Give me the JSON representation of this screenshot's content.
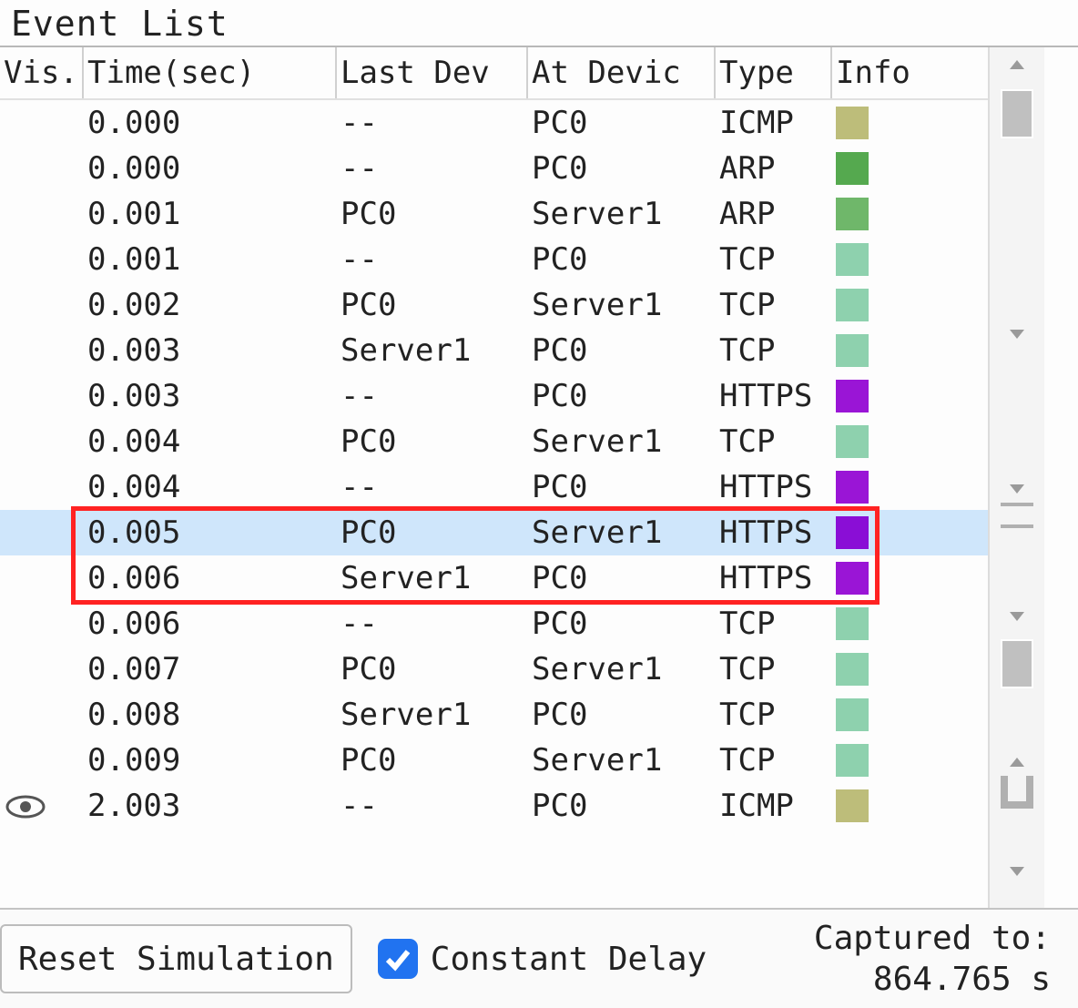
{
  "title": "Event List",
  "headers": {
    "vis": "Vis.",
    "time": "Time(sec)",
    "last": "Last Dev",
    "at": "At Devic",
    "type": "Type",
    "info": "Info"
  },
  "rows": [
    {
      "vis": "",
      "time": "0.000",
      "last": "--",
      "at": "PC0",
      "type": "ICMP",
      "color": "#bdbd7a",
      "sel": false
    },
    {
      "vis": "",
      "time": "0.000",
      "last": "--",
      "at": "PC0",
      "type": "ARP",
      "color": "#55a94f",
      "sel": false
    },
    {
      "vis": "",
      "time": "0.001",
      "last": "PC0",
      "at": "Server1",
      "type": "ARP",
      "color": "#6fb76a",
      "sel": false
    },
    {
      "vis": "",
      "time": "0.001",
      "last": "--",
      "at": "PC0",
      "type": "TCP",
      "color": "#8ed1ae",
      "sel": false
    },
    {
      "vis": "",
      "time": "0.002",
      "last": "PC0",
      "at": "Server1",
      "type": "TCP",
      "color": "#8ed1ae",
      "sel": false
    },
    {
      "vis": "",
      "time": "0.003",
      "last": "Server1",
      "at": "PC0",
      "type": "TCP",
      "color": "#8ed1ae",
      "sel": false
    },
    {
      "vis": "",
      "time": "0.003",
      "last": "--",
      "at": "PC0",
      "type": "HTTPS",
      "color": "#9a15d6",
      "sel": false
    },
    {
      "vis": "",
      "time": "0.004",
      "last": "PC0",
      "at": "Server1",
      "type": "TCP",
      "color": "#8ed1ae",
      "sel": false
    },
    {
      "vis": "",
      "time": "0.004",
      "last": "--",
      "at": "PC0",
      "type": "HTTPS",
      "color": "#9a15d6",
      "sel": false
    },
    {
      "vis": "",
      "time": "0.005",
      "last": "PC0",
      "at": "Server1",
      "type": "HTTPS",
      "color": "#8a0ed6",
      "sel": true
    },
    {
      "vis": "",
      "time": "0.006",
      "last": "Server1",
      "at": "PC0",
      "type": "HTTPS",
      "color": "#9a15d6",
      "sel": false
    },
    {
      "vis": "",
      "time": "0.006",
      "last": "--",
      "at": "PC0",
      "type": "TCP",
      "color": "#8ed1ae",
      "sel": false
    },
    {
      "vis": "",
      "time": "0.007",
      "last": "PC0",
      "at": "Server1",
      "type": "TCP",
      "color": "#8ed1ae",
      "sel": false
    },
    {
      "vis": "",
      "time": "0.008",
      "last": "Server1",
      "at": "PC0",
      "type": "TCP",
      "color": "#8ed1ae",
      "sel": false
    },
    {
      "vis": "",
      "time": "0.009",
      "last": "PC0",
      "at": "Server1",
      "type": "TCP",
      "color": "#8ed1ae",
      "sel": false
    },
    {
      "vis": "eye",
      "time": "2.003",
      "last": "--",
      "at": "PC0",
      "type": "ICMP",
      "color": "#bdbd7a",
      "sel": false
    }
  ],
  "highlight_rows": [
    9,
    10
  ],
  "footer": {
    "reset_label": "Reset Simulation",
    "constant_delay_label": "Constant Delay",
    "constant_delay_checked": true,
    "captured_label": "Captured to:",
    "captured_value": "864.765 s"
  }
}
